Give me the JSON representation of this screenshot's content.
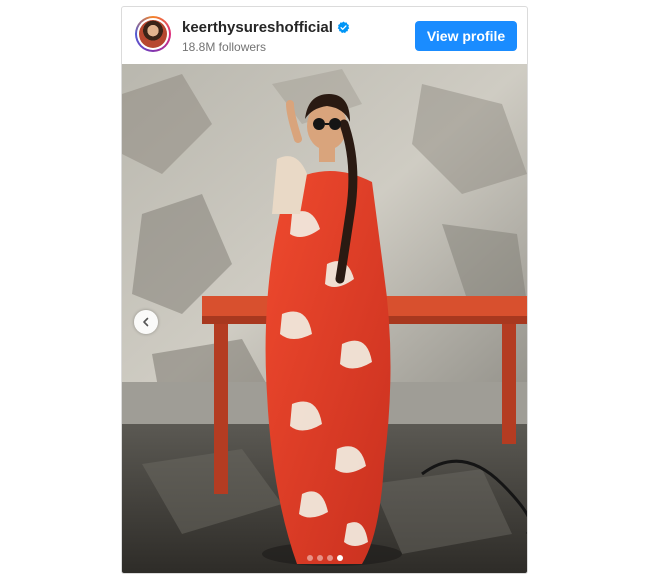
{
  "profile": {
    "username": "keerthysureshofficial",
    "followers": "18.8M followers",
    "verified_icon": "verified-badge-icon",
    "view_profile_label": "View profile"
  },
  "carousel": {
    "slide_count": 4,
    "active_index": 3,
    "prev_icon": "chevron-left-icon"
  },
  "colors": {
    "button": "#1a8cff",
    "verified": "#0095f6",
    "saree_red": "#e8422b",
    "bench": "#d8502e"
  }
}
